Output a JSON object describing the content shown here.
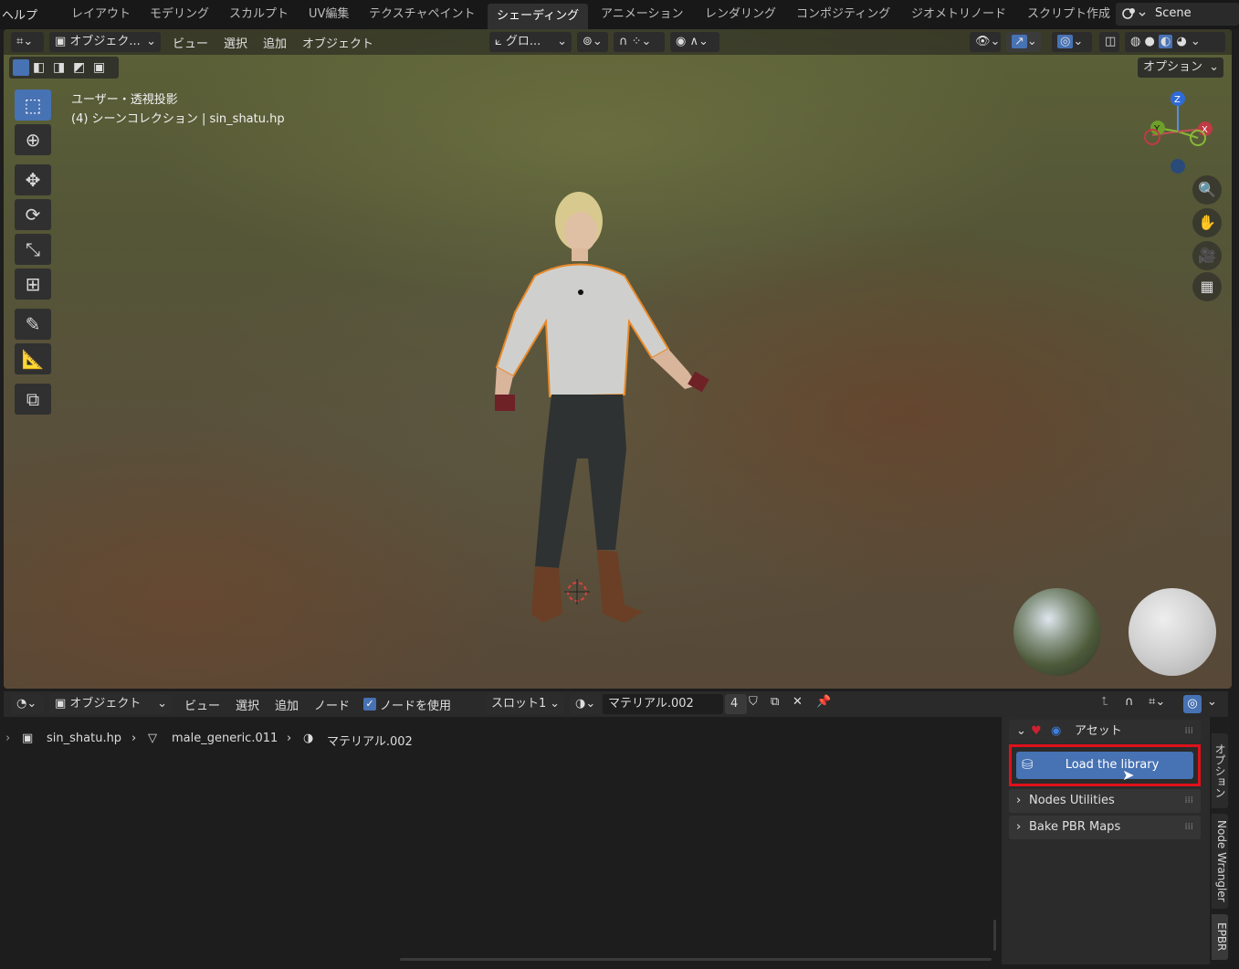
{
  "topbar": {
    "help": "ヘルプ",
    "workspaces": [
      "レイアウト",
      "モデリング",
      "スカルプト",
      "UV編集",
      "テクスチャペイント",
      "シェーディング",
      "アニメーション",
      "レンダリング",
      "コンポジティング",
      "ジオメトリノード",
      "スクリプト作成"
    ],
    "active_workspace": "シェーディング",
    "scene": "Scene"
  },
  "viewport": {
    "mode": "オブジェク...",
    "menus": {
      "view": "ビュー",
      "select": "選択",
      "add": "追加",
      "object": "オブジェクト"
    },
    "orientation": "グロ...",
    "options": "オプション",
    "info_line1": "ユーザー・透視投影",
    "info_line2": "(4) シーンコレクション | sin_shatu.hp",
    "gizmo": {
      "z": "Z",
      "y": "Y",
      "x": "X"
    }
  },
  "node_editor": {
    "mode": "オブジェクト",
    "menus": {
      "view": "ビュー",
      "select": "選択",
      "add": "追加",
      "node": "ノード"
    },
    "use_nodes_label": "ノードを使用",
    "use_nodes_checked": true,
    "slot": "スロット1",
    "material": "マテリアル.002",
    "user_count": "4",
    "breadcrumb": {
      "object": "sin_shatu.hp",
      "mesh": "male_generic.011",
      "material": "マテリアル.002"
    }
  },
  "sidebar": {
    "asset_panel": "アセット",
    "load_button": "Load the library",
    "panels": [
      "Nodes Utilities",
      "Bake PBR Maps"
    ],
    "tabs": [
      "オプション",
      "Node Wrangler",
      "EPBR"
    ]
  },
  "colors": {
    "accent": "#4772b3",
    "highlight_box": "#e0101a",
    "selection_outline": "#e8892a"
  }
}
